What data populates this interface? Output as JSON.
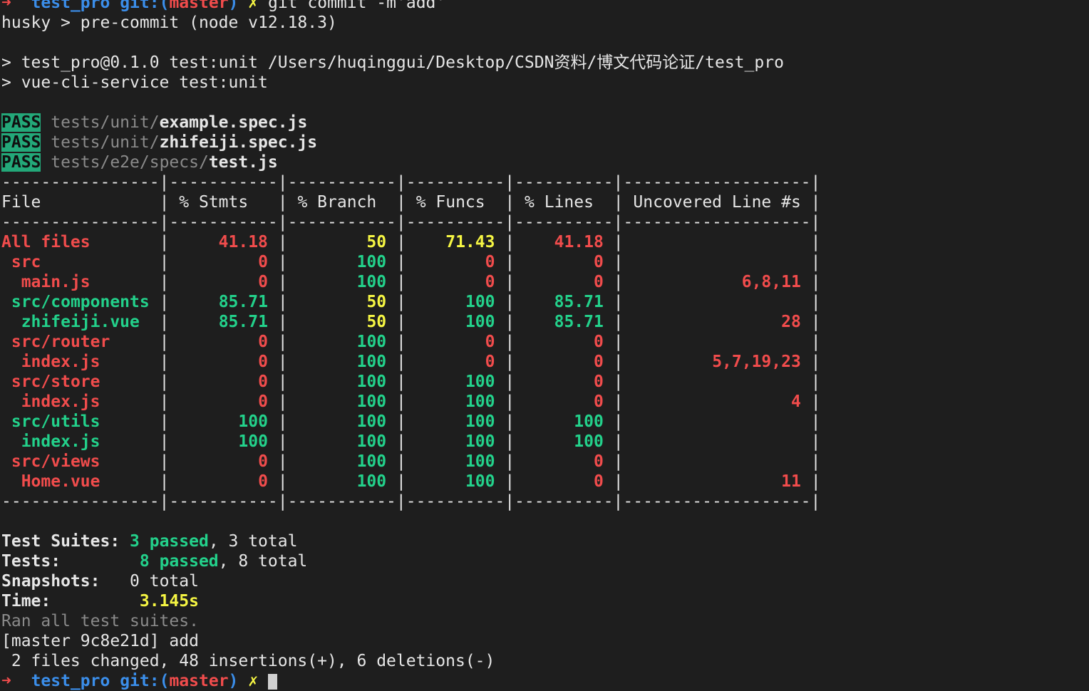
{
  "command_prompt": {
    "arrow": "➜",
    "dir": "test_pro",
    "git_label": "git:",
    "branch_open": "(",
    "branch": "master",
    "branch_close": ")",
    "dirty": "✗",
    "command": "git commit -m'add'"
  },
  "husky_line": "husky > pre-commit (node v12.18.3)",
  "npm_line1": "> test_pro@0.1.0 test:unit /Users/huqinggui/Desktop/CSDN资料/博文代码论证/test_pro",
  "npm_line2": "> vue-cli-service test:unit",
  "results": [
    {
      "status": "PASS",
      "dir": "tests/unit/",
      "file": "example.spec.js"
    },
    {
      "status": "PASS",
      "dir": "tests/unit/",
      "file": "zhifeiji.spec.js"
    },
    {
      "status": "PASS",
      "dir": "tests/e2e/specs/",
      "file": "test.js"
    }
  ],
  "coverage": {
    "border_line": "----------------|-----------|-----------|----------|----------|-------------------|",
    "headers": [
      "File",
      "% Stmts",
      "% Branch",
      "% Funcs",
      "% Lines",
      "Uncovered Line #s"
    ],
    "rows": [
      {
        "file": "All files",
        "indent": 0,
        "stmts": "41.18",
        "branch": "50",
        "funcs": "71.43",
        "lines": "41.18",
        "uncovered": ""
      },
      {
        "file": "src",
        "indent": 1,
        "stmts": "0",
        "branch": "100",
        "funcs": "0",
        "lines": "0",
        "uncovered": ""
      },
      {
        "file": "main.js",
        "indent": 2,
        "stmts": "0",
        "branch": "100",
        "funcs": "0",
        "lines": "0",
        "uncovered": "6,8,11"
      },
      {
        "file": "src/components",
        "indent": 1,
        "stmts": "85.71",
        "branch": "50",
        "funcs": "100",
        "lines": "85.71",
        "uncovered": ""
      },
      {
        "file": "zhifeiji.vue",
        "indent": 2,
        "stmts": "85.71",
        "branch": "50",
        "funcs": "100",
        "lines": "85.71",
        "uncovered": "28"
      },
      {
        "file": "src/router",
        "indent": 1,
        "stmts": "0",
        "branch": "100",
        "funcs": "0",
        "lines": "0",
        "uncovered": ""
      },
      {
        "file": "index.js",
        "indent": 2,
        "stmts": "0",
        "branch": "100",
        "funcs": "0",
        "lines": "0",
        "uncovered": "5,7,19,23"
      },
      {
        "file": "src/store",
        "indent": 1,
        "stmts": "0",
        "branch": "100",
        "funcs": "100",
        "lines": "0",
        "uncovered": ""
      },
      {
        "file": "index.js",
        "indent": 2,
        "stmts": "0",
        "branch": "100",
        "funcs": "100",
        "lines": "0",
        "uncovered": "4"
      },
      {
        "file": "src/utils",
        "indent": 1,
        "stmts": "100",
        "branch": "100",
        "funcs": "100",
        "lines": "100",
        "uncovered": ""
      },
      {
        "file": "index.js",
        "indent": 2,
        "stmts": "100",
        "branch": "100",
        "funcs": "100",
        "lines": "100",
        "uncovered": ""
      },
      {
        "file": "src/views",
        "indent": 1,
        "stmts": "0",
        "branch": "100",
        "funcs": "100",
        "lines": "0",
        "uncovered": ""
      },
      {
        "file": "Home.vue",
        "indent": 2,
        "stmts": "0",
        "branch": "100",
        "funcs": "100",
        "lines": "0",
        "uncovered": "11"
      }
    ]
  },
  "summary": {
    "suites_label": "Test Suites:",
    "suites_passed": "3 passed",
    "suites_total": ", 3 total",
    "tests_label": "Tests:",
    "tests_passed": "8 passed",
    "tests_total": ", 8 total",
    "snapshots_label": "Snapshots:",
    "snapshots_value": "0 total",
    "time_label": "Time:",
    "time_value": "3.145s",
    "ran_all": "Ran all test suites."
  },
  "commit_line": "[master 9c8e21d] add",
  "changes_line": " 2 files changed, 48 insertions(+), 6 deletions(-)",
  "final_prompt": {
    "arrow": "➜",
    "dir": "test_pro",
    "git_label": "git:",
    "branch_open": "(",
    "branch": "master",
    "branch_close": ")",
    "dirty": "✗"
  },
  "colors": {
    "background": "#1e1e1e",
    "red": "#f14c4c",
    "green": "#23d18b",
    "yellow": "#f5f543",
    "blue": "#3b8eea",
    "pass_badge": "#23a879"
  }
}
